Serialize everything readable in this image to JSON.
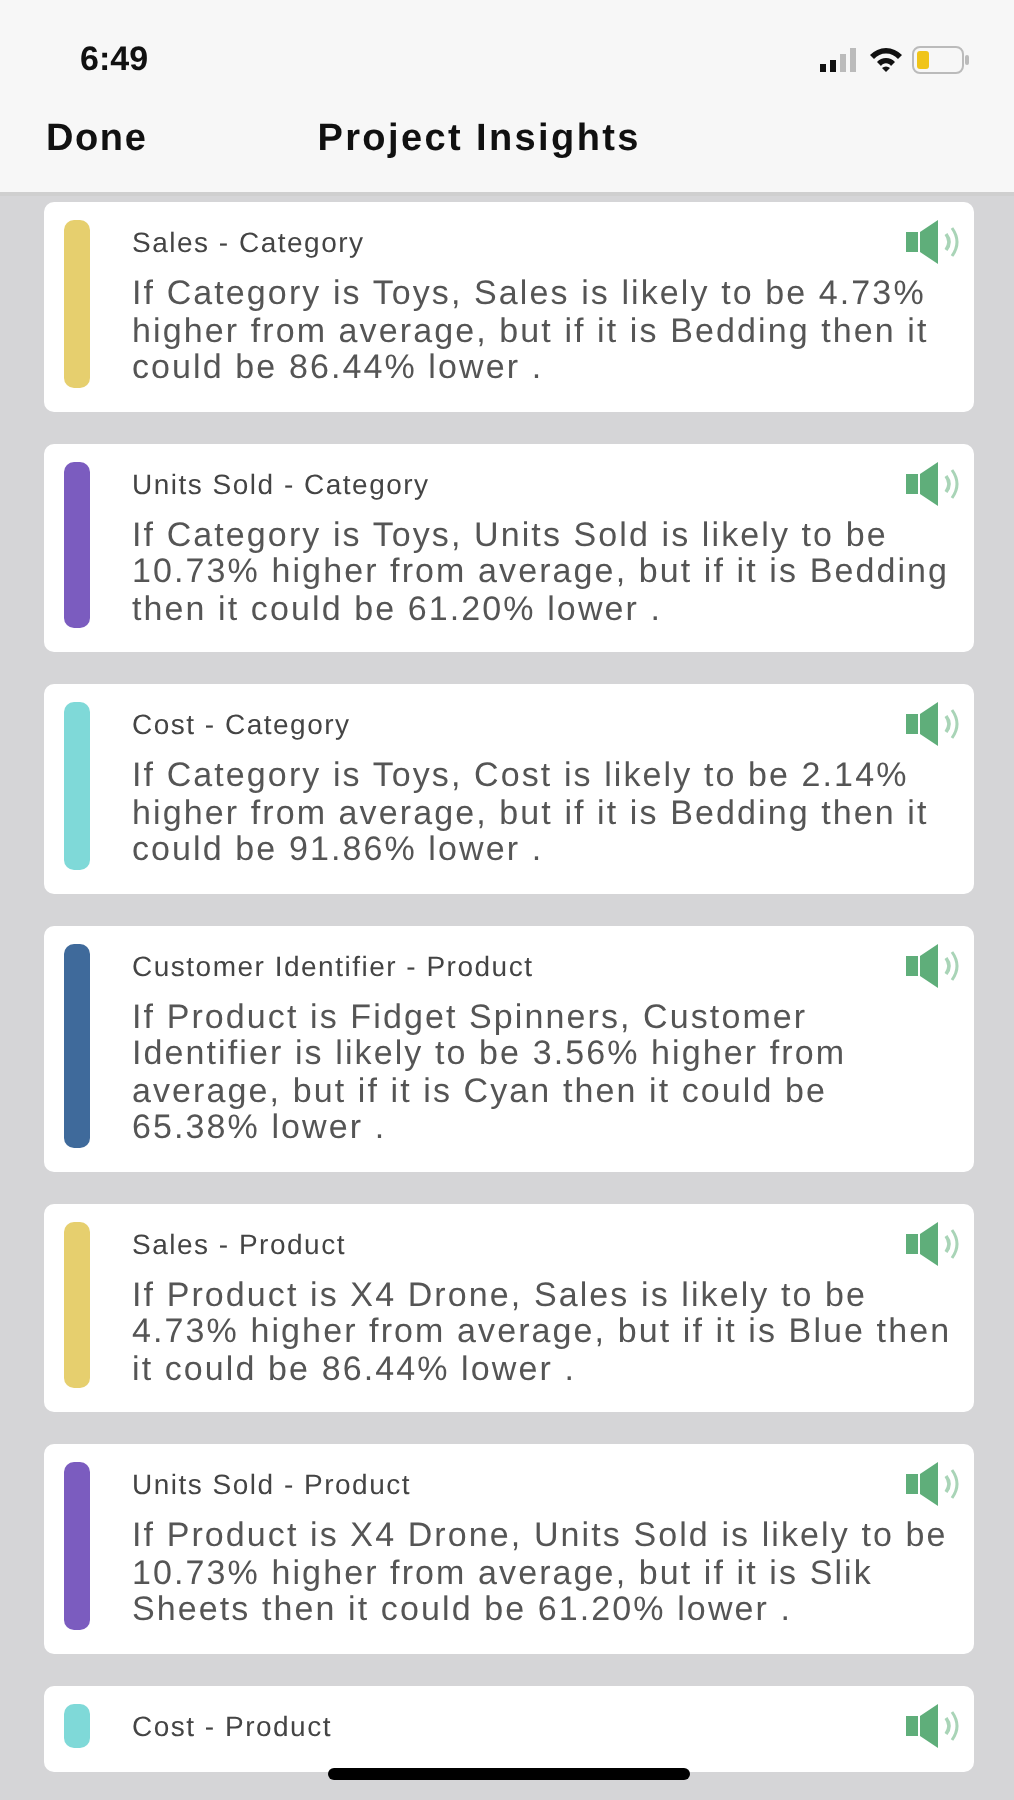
{
  "status_bar": {
    "time": "6:49"
  },
  "nav": {
    "done": "Done",
    "title": "Project Insights"
  },
  "insights": [
    {
      "title": "Sales - Category",
      "text": "If Category is Toys, Sales is likely to be 4.73% higher from average, but if it is Bedding then it could be 86.44% lower .",
      "color": "#e6cf6e"
    },
    {
      "title": "Units Sold - Category",
      "text": "If Category is Toys, Units Sold is likely to be 10.73% higher from average, but if it is Bedding then it could be 61.20% lower .",
      "color": "#7b5cbf"
    },
    {
      "title": "Cost - Category",
      "text": "If Category is Toys, Cost is likely to be 2.14% higher from average, but if it is Bedding then it could be 91.86% lower .",
      "color": "#7fd9d8"
    },
    {
      "title": "Customer Identifier - Product",
      "text": "If Product is Fidget Spinners, Customer Identifier is likely to be 3.56% higher from average, but if it is Cyan then it could be 65.38% lower .",
      "color": "#3f6a9b"
    },
    {
      "title": "Sales - Product",
      "text": "If Product is X4 Drone, Sales is likely to be 4.73% higher from average, but if it is Blue then it could be 86.44% lower .",
      "color": "#e6cf6e"
    },
    {
      "title": "Units Sold - Product",
      "text": "If Product is X4 Drone, Units Sold is likely to be 10.73% higher from average, but if it is Slik Sheets then it could be 61.20% lower .",
      "color": "#7b5cbf"
    },
    {
      "title": "Cost - Product",
      "color": "#7fd9d8"
    }
  ]
}
